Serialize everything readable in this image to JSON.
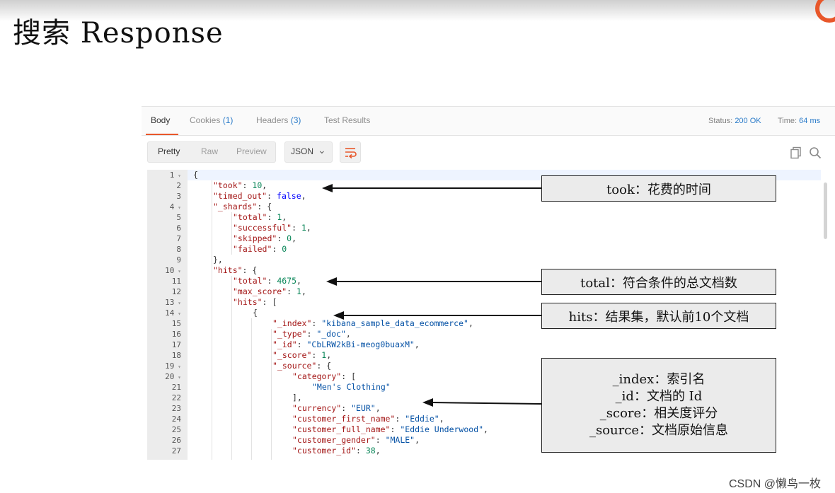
{
  "slide": {
    "title": "搜索 Response"
  },
  "tabs": [
    {
      "label": "Body",
      "count": ""
    },
    {
      "label": "Cookies",
      "count": "(1)"
    },
    {
      "label": "Headers",
      "count": "(3)"
    },
    {
      "label": "Test Results",
      "count": ""
    }
  ],
  "status": {
    "label": "Status:",
    "value": "200 OK"
  },
  "time": {
    "label": "Time:",
    "value": "64 ms"
  },
  "view_modes": [
    "Pretty",
    "Raw",
    "Preview"
  ],
  "selected_view": "Pretty",
  "format": "JSON",
  "line_numbers": [
    "1",
    "2",
    "3",
    "4",
    "5",
    "6",
    "7",
    "8",
    "9",
    "10",
    "11",
    "12",
    "13",
    "14",
    "15",
    "16",
    "17",
    "18",
    "19",
    "20",
    "21",
    "22",
    "23",
    "24",
    "25",
    "26",
    "27"
  ],
  "code": [
    [
      {
        "t": "{",
        "c": "p"
      }
    ],
    [
      {
        "t": "\"took\"",
        "c": "key"
      },
      {
        "t": ": ",
        "c": "p"
      },
      {
        "t": "10",
        "c": "num"
      },
      {
        "t": ",",
        "c": "p"
      }
    ],
    [
      {
        "t": "\"timed_out\"",
        "c": "key"
      },
      {
        "t": ": ",
        "c": "p"
      },
      {
        "t": "false",
        "c": "kw"
      },
      {
        "t": ",",
        "c": "p"
      }
    ],
    [
      {
        "t": "\"_shards\"",
        "c": "key"
      },
      {
        "t": ": {",
        "c": "p"
      }
    ],
    [
      {
        "t": "\"total\"",
        "c": "key"
      },
      {
        "t": ": ",
        "c": "p"
      },
      {
        "t": "1",
        "c": "num"
      },
      {
        "t": ",",
        "c": "p"
      }
    ],
    [
      {
        "t": "\"successful\"",
        "c": "key"
      },
      {
        "t": ": ",
        "c": "p"
      },
      {
        "t": "1",
        "c": "num"
      },
      {
        "t": ",",
        "c": "p"
      }
    ],
    [
      {
        "t": "\"skipped\"",
        "c": "key"
      },
      {
        "t": ": ",
        "c": "p"
      },
      {
        "t": "0",
        "c": "num"
      },
      {
        "t": ",",
        "c": "p"
      }
    ],
    [
      {
        "t": "\"failed\"",
        "c": "key"
      },
      {
        "t": ": ",
        "c": "p"
      },
      {
        "t": "0",
        "c": "num"
      }
    ],
    [
      {
        "t": "},",
        "c": "p"
      }
    ],
    [
      {
        "t": "\"hits\"",
        "c": "key"
      },
      {
        "t": ": {",
        "c": "p"
      }
    ],
    [
      {
        "t": "\"total\"",
        "c": "key"
      },
      {
        "t": ": ",
        "c": "p"
      },
      {
        "t": "4675",
        "c": "num"
      },
      {
        "t": ",",
        "c": "p"
      }
    ],
    [
      {
        "t": "\"max_score\"",
        "c": "key"
      },
      {
        "t": ": ",
        "c": "p"
      },
      {
        "t": "1",
        "c": "num"
      },
      {
        "t": ",",
        "c": "p"
      }
    ],
    [
      {
        "t": "\"hits\"",
        "c": "key"
      },
      {
        "t": ": [",
        "c": "p"
      }
    ],
    [
      {
        "t": "{",
        "c": "p"
      }
    ],
    [
      {
        "t": "\"_index\"",
        "c": "key"
      },
      {
        "t": ": ",
        "c": "p"
      },
      {
        "t": "\"kibana_sample_data_ecommerce\"",
        "c": "str"
      },
      {
        "t": ",",
        "c": "p"
      }
    ],
    [
      {
        "t": "\"_type\"",
        "c": "key"
      },
      {
        "t": ": ",
        "c": "p"
      },
      {
        "t": "\"_doc\"",
        "c": "str"
      },
      {
        "t": ",",
        "c": "p"
      }
    ],
    [
      {
        "t": "\"_id\"",
        "c": "key"
      },
      {
        "t": ": ",
        "c": "p"
      },
      {
        "t": "\"CbLRW2kBi-meog0buaxM\"",
        "c": "str"
      },
      {
        "t": ",",
        "c": "p"
      }
    ],
    [
      {
        "t": "\"_score\"",
        "c": "key"
      },
      {
        "t": ": ",
        "c": "p"
      },
      {
        "t": "1",
        "c": "num"
      },
      {
        "t": ",",
        "c": "p"
      }
    ],
    [
      {
        "t": "\"_source\"",
        "c": "key"
      },
      {
        "t": ": {",
        "c": "p"
      }
    ],
    [
      {
        "t": "\"category\"",
        "c": "key"
      },
      {
        "t": ": [",
        "c": "p"
      }
    ],
    [
      {
        "t": "\"Men's Clothing\"",
        "c": "str"
      }
    ],
    [
      {
        "t": "],",
        "c": "p"
      }
    ],
    [
      {
        "t": "\"currency\"",
        "c": "key"
      },
      {
        "t": ": ",
        "c": "p"
      },
      {
        "t": "\"EUR\"",
        "c": "str"
      },
      {
        "t": ",",
        "c": "p"
      }
    ],
    [
      {
        "t": "\"customer_first_name\"",
        "c": "key"
      },
      {
        "t": ": ",
        "c": "p"
      },
      {
        "t": "\"Eddie\"",
        "c": "str"
      },
      {
        "t": ",",
        "c": "p"
      }
    ],
    [
      {
        "t": "\"customer_full_name\"",
        "c": "key"
      },
      {
        "t": ": ",
        "c": "p"
      },
      {
        "t": "\"Eddie Underwood\"",
        "c": "str"
      },
      {
        "t": ",",
        "c": "p"
      }
    ],
    [
      {
        "t": "\"customer_gender\"",
        "c": "key"
      },
      {
        "t": ": ",
        "c": "p"
      },
      {
        "t": "\"MALE\"",
        "c": "str"
      },
      {
        "t": ",",
        "c": "p"
      }
    ],
    [
      {
        "t": "\"customer_id\"",
        "c": "key"
      },
      {
        "t": ": ",
        "c": "p"
      },
      {
        "t": "38",
        "c": "num"
      },
      {
        "t": ",",
        "c": "p"
      }
    ]
  ],
  "annotations": {
    "took": "took：花费的时间",
    "total": "total：符合条件的总文档数",
    "hits": "hits：结果集，默认前10个文档",
    "fields": [
      "_index：索引名",
      "_id：文档的 Id",
      "_score：相关度评分",
      "_source：文档原始信息"
    ]
  },
  "watermark": "CSDN @懒鸟一枚",
  "colors": {
    "accent": "#e8572a",
    "link": "#2b7bc9",
    "key": "#a31515",
    "string": "#0451a5",
    "number": "#098658",
    "keyword": "#0000ff"
  }
}
